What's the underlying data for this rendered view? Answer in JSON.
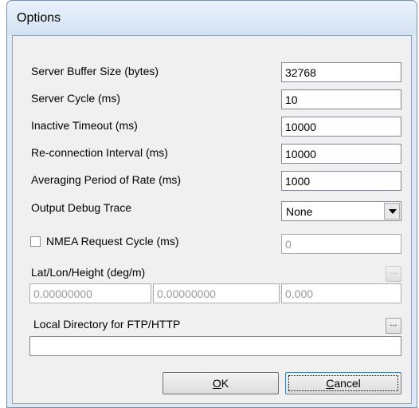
{
  "window": {
    "title": "Options"
  },
  "fields": {
    "server_buffer_size": {
      "label": "Server Buffer Size (bytes)",
      "value": "32768"
    },
    "server_cycle": {
      "label": "Server Cycle  (ms)",
      "value": "10"
    },
    "inactive_timeout": {
      "label": "Inactive Timeout  (ms)",
      "value": "10000"
    },
    "reconnection_interval": {
      "label": "Re-connection Interval  (ms)",
      "value": "10000"
    },
    "averaging_period": {
      "label": "Averaging Period of Rate (ms)",
      "value": "1000"
    },
    "output_debug_trace": {
      "label": "Output Debug Trace",
      "value": "None"
    },
    "nmea_request_cycle": {
      "label": "NMEA Request Cycle (ms)",
      "value": "0",
      "checked": false
    },
    "lat_lon_height": {
      "label": "Lat/Lon/Height (deg/m)",
      "lat": "0.00000000",
      "lon": "0.00000000",
      "height": "0.000",
      "button": "..."
    },
    "local_directory": {
      "label": "Local Directory for FTP/HTTP",
      "value": "",
      "button": "..."
    }
  },
  "buttons": {
    "ok": {
      "mnemonic": "O",
      "rest": "K"
    },
    "cancel": {
      "mnemonic": "C",
      "rest": "ancel"
    }
  },
  "icons": {
    "dropdown": "chevron-down-icon",
    "checkbox": "checkbox-unchecked"
  }
}
